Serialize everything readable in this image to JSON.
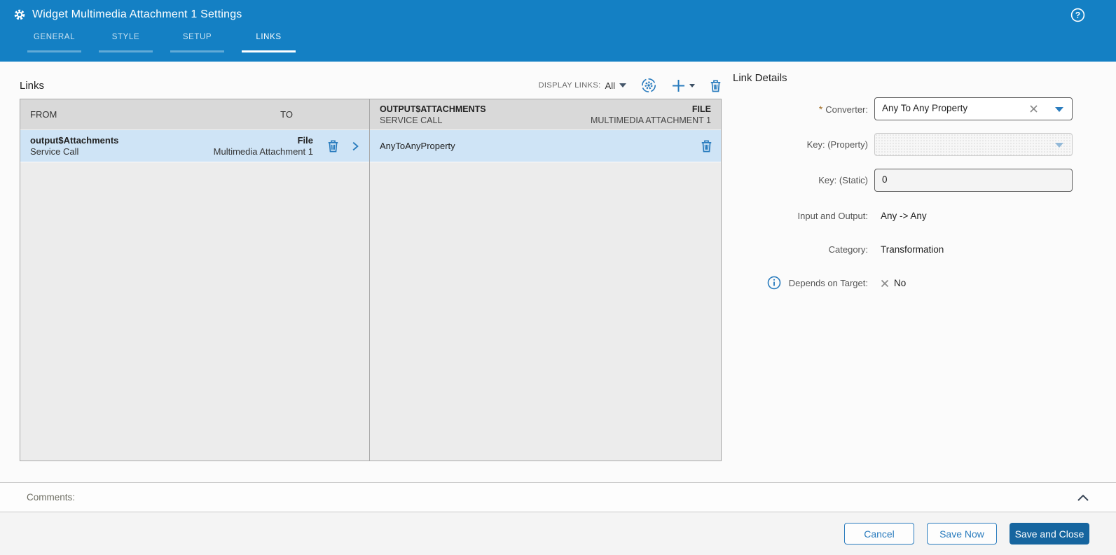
{
  "window": {
    "title": "Widget Multimedia Attachment 1 Settings"
  },
  "tabs": [
    {
      "label": "GENERAL",
      "active": false
    },
    {
      "label": "STYLE",
      "active": false
    },
    {
      "label": "SETUP",
      "active": false
    },
    {
      "label": "LINKS",
      "active": true
    }
  ],
  "links_section": {
    "title": "Links",
    "toolbar": {
      "display_links_label": "DISPLAY LINKS:",
      "display_links_value": "All",
      "icons": [
        "auto-bind-gear-icon",
        "add-link-icon",
        "delete-link-icon"
      ]
    },
    "from_to_table": {
      "header_from": "FROM",
      "header_to": "TO",
      "rows": [
        {
          "from_primary": "output$Attachments",
          "from_secondary": "Service Call",
          "to_primary": "File",
          "to_secondary": "Multimedia Attachment 1"
        }
      ]
    },
    "binding_table": {
      "header_left_primary": "OUTPUT$ATTACHMENTS",
      "header_left_secondary": "SERVICE CALL",
      "header_right_primary": "FILE",
      "header_right_secondary": "MULTIMEDIA ATTACHMENT 1",
      "rows": [
        {
          "name": "AnyToAnyProperty"
        }
      ]
    }
  },
  "link_details": {
    "title": "Link Details",
    "converter": {
      "required_mark": "*",
      "label": "Converter:",
      "value": "Any To Any Property"
    },
    "key_property": {
      "label": "Key: (Property)",
      "value": ""
    },
    "key_static": {
      "label": "Key: (Static)",
      "value": "0"
    },
    "input_output": {
      "label": "Input and Output:",
      "value": "Any -> Any"
    },
    "category": {
      "label": "Category:",
      "value": "Transformation"
    },
    "depends_on_target": {
      "label": "Depends on Target:",
      "value": "No"
    }
  },
  "comments": {
    "label": "Comments:"
  },
  "footer": {
    "cancel_label": "Cancel",
    "save_now_label": "Save Now",
    "save_close_label": "Save and Close"
  },
  "colors": {
    "header_blue": "#1480c4",
    "icon_blue": "#2a7cbe",
    "selected_row": "#cfe4f6",
    "table_header_bg": "#d9d9d9",
    "table_body_bg": "#ececec",
    "primary_btn": "#16659f",
    "required": "#a06c22"
  }
}
